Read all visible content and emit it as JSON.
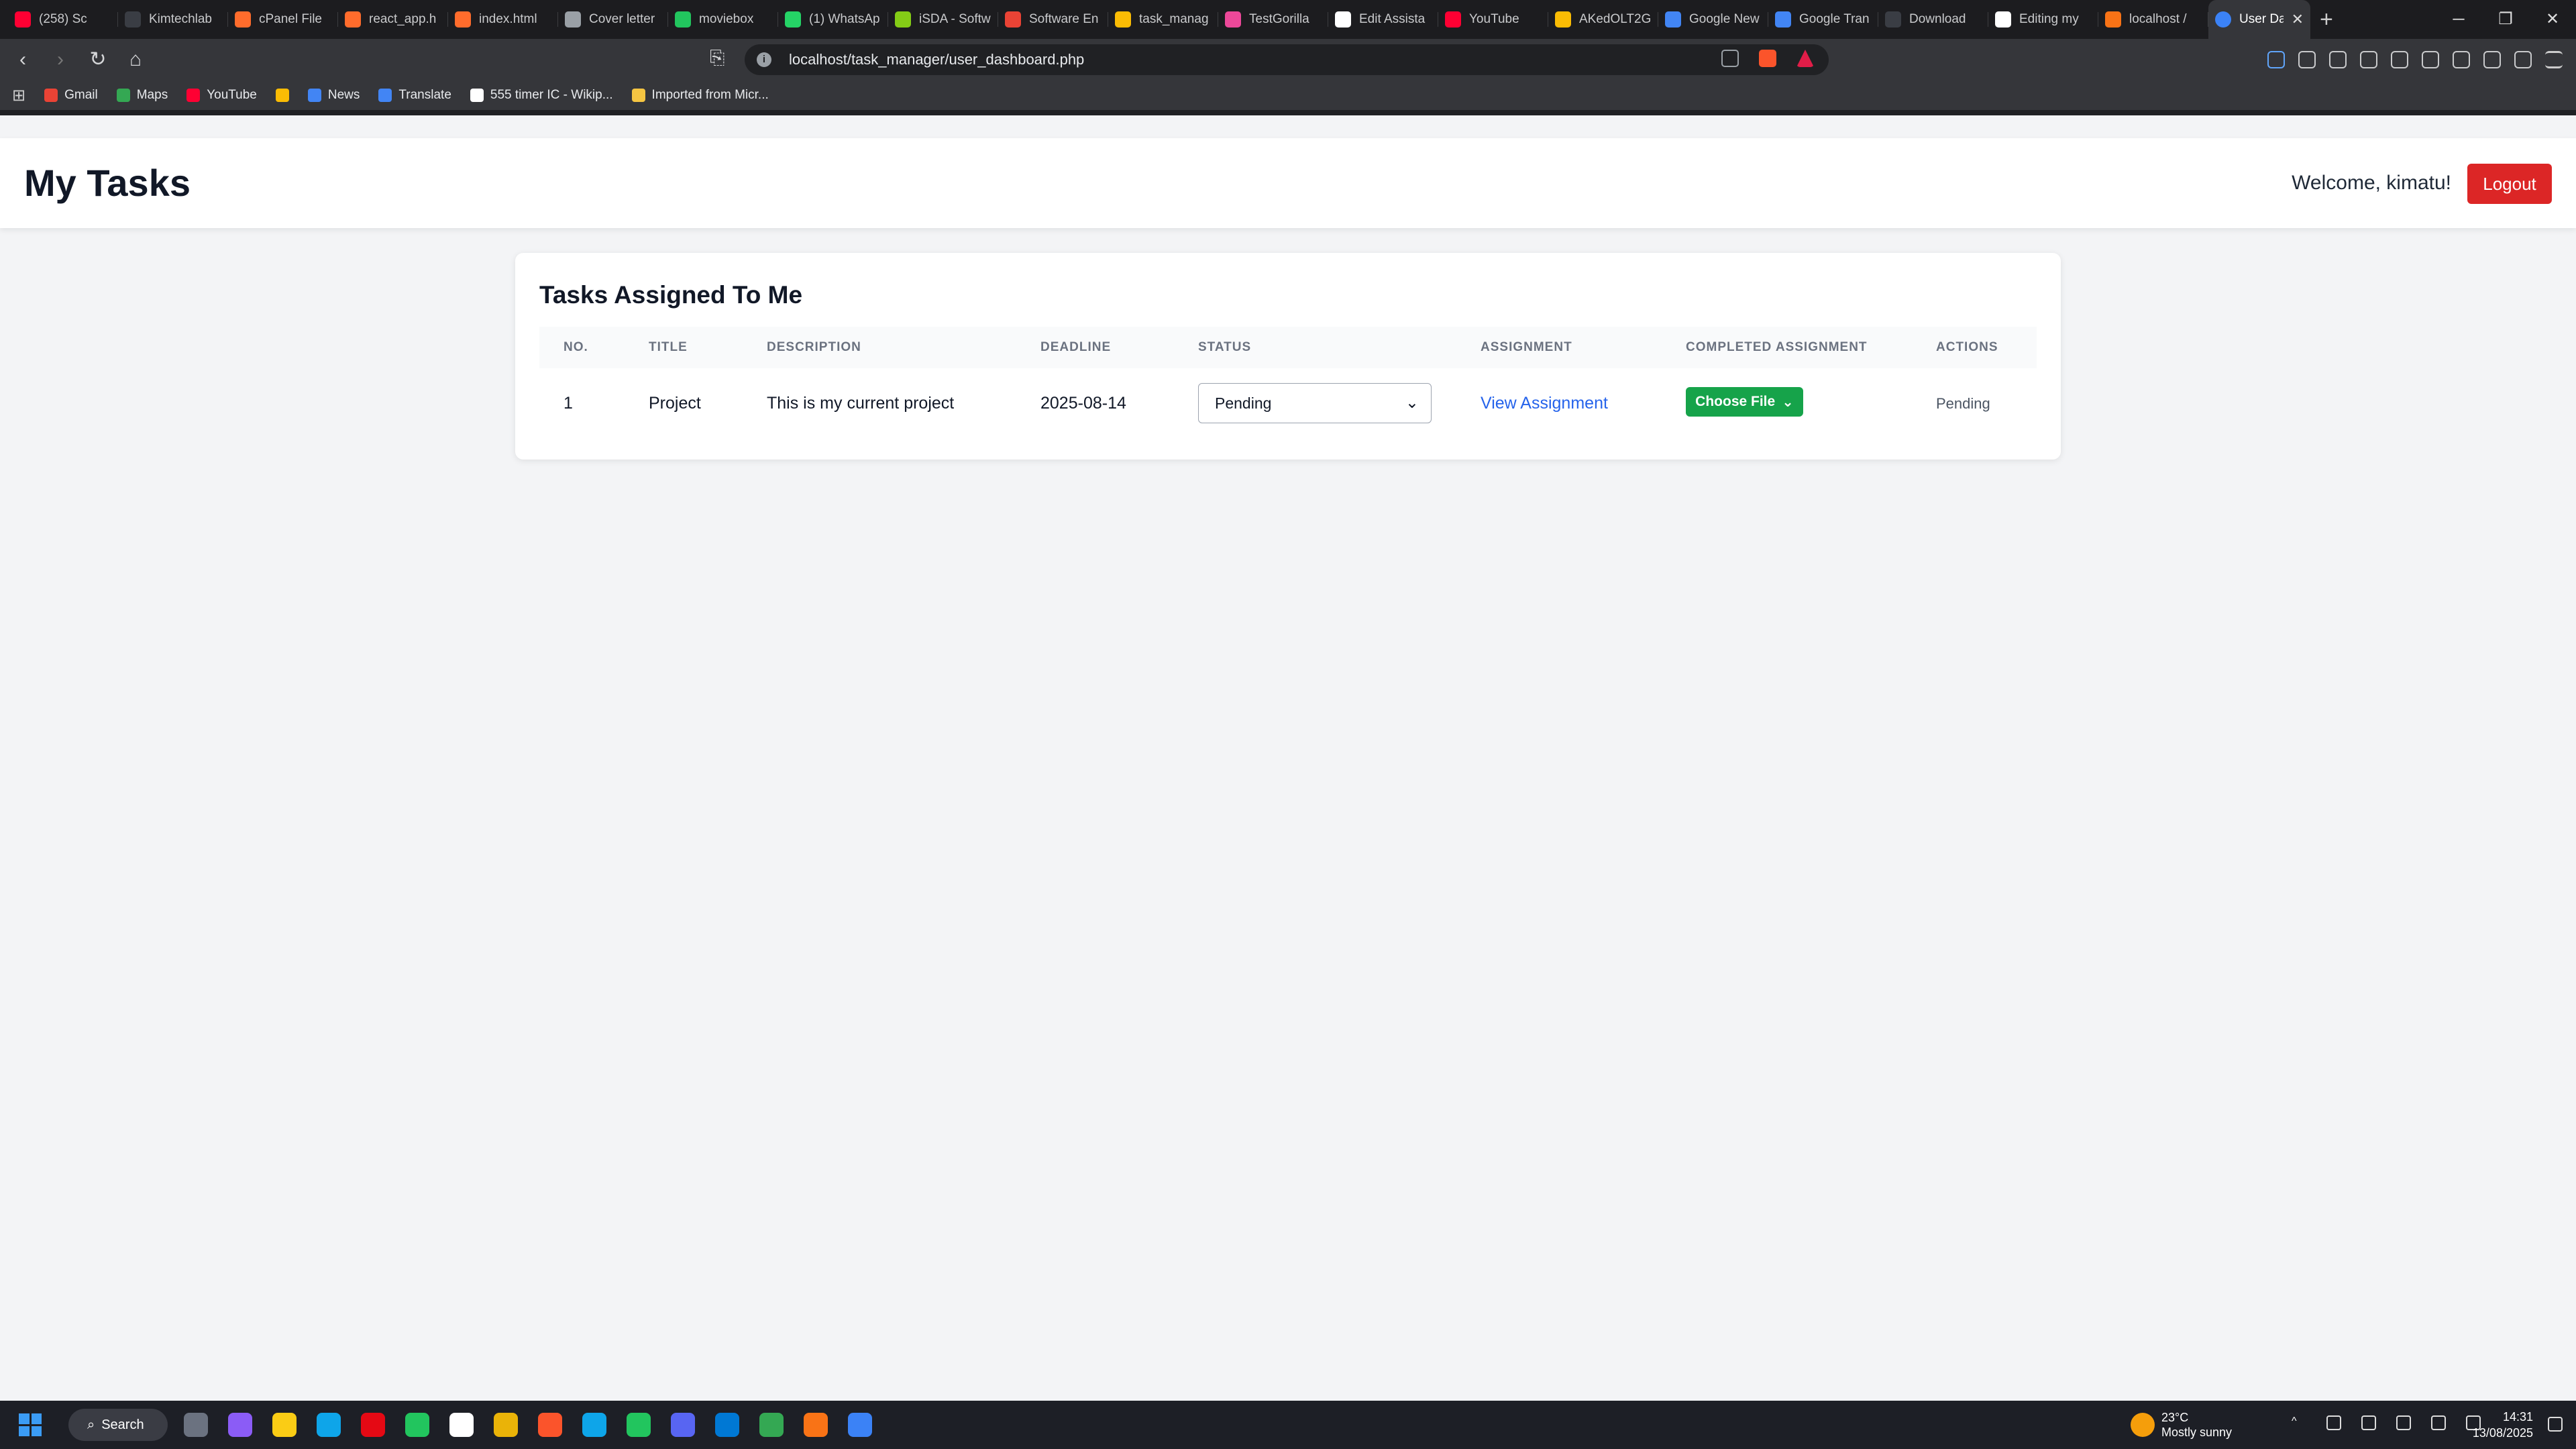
{
  "browser": {
    "tabs": [
      {
        "label": "(258) Sc",
        "color": "#ff0033"
      },
      {
        "label": "Kimtechlab",
        "color": "#3a3d44"
      },
      {
        "label": "cPanel File",
        "color": "#ff6c2c"
      },
      {
        "label": "react_app.h",
        "color": "#ff6c2c"
      },
      {
        "label": "index.html",
        "color": "#ff6c2c"
      },
      {
        "label": "Cover letter",
        "color": "#9aa0a6"
      },
      {
        "label": "moviebox",
        "color": "#22c55e"
      },
      {
        "label": "(1) WhatsAp",
        "color": "#25d366"
      },
      {
        "label": "iSDA - Softw",
        "color": "#84cc16"
      },
      {
        "label": "Software En",
        "color": "#ea4335"
      },
      {
        "label": "task_manag",
        "color": "#fbbc04"
      },
      {
        "label": "TestGorilla",
        "color": "#ec4899"
      },
      {
        "label": "Edit Assista",
        "color": "#ffffff"
      },
      {
        "label": "YouTube",
        "color": "#ff0033"
      },
      {
        "label": "AKedOLT2G",
        "color": "#fbbc04"
      },
      {
        "label": "Google New",
        "color": "#4285f4"
      },
      {
        "label": "Google Tran",
        "color": "#4285f4"
      },
      {
        "label": "Download",
        "color": "#3a3d44"
      },
      {
        "label": "Editing my",
        "color": "#ffffff"
      },
      {
        "label": "localhost /",
        "color": "#f97316"
      }
    ],
    "active_tab": {
      "label": "User Da",
      "color": "#3b82f6"
    },
    "new_tab": "+",
    "url": "localhost/task_manager/user_dashboard.php",
    "bookmarks": [
      {
        "label": "Gmail",
        "color": "#ea4335"
      },
      {
        "label": "Maps",
        "color": "#34a853"
      },
      {
        "label": "YouTube",
        "color": "#ff0033"
      },
      {
        "label": "",
        "color": "#fbbc04"
      },
      {
        "label": "News",
        "color": "#4285f4"
      },
      {
        "label": "Translate",
        "color": "#4285f4"
      },
      {
        "label": "555 timer IC - Wikip...",
        "color": "#ffffff"
      },
      {
        "label": "Imported from Micr...",
        "color": "#f5c542"
      }
    ]
  },
  "header": {
    "title": "My Tasks",
    "welcome": "Welcome, kimatu!",
    "logout_label": "Logout"
  },
  "tasks": {
    "title": "Tasks Assigned To Me",
    "columns": [
      "NO.",
      "TITLE",
      "DESCRIPTION",
      "DEADLINE",
      "STATUS",
      "ASSIGNMENT",
      "COMPLETED ASSIGNMENT",
      "ACTIONS"
    ],
    "rows": [
      {
        "no": "1",
        "title": "Project",
        "description": "This is my current project",
        "deadline": "2025-08-14",
        "status": "Pending",
        "assignment_link": "View Assignment",
        "upload_label": "Choose File",
        "action": "Pending"
      }
    ]
  },
  "taskbar": {
    "search_label": "Search",
    "weather_temp": "23°C",
    "weather_desc": "Mostly sunny",
    "time": "14:31",
    "date": "13/08/2025",
    "apps": [
      "#6b7280",
      "#8b5cf6",
      "#facc15",
      "#0ea5e9",
      "#e50914",
      "#22c55e",
      "#ffffff",
      "#eab308",
      "#fb542b",
      "#0ea5e9",
      "#22c55e",
      "#5865f2",
      "#0078d4",
      "#34a853",
      "#f97316",
      "#3b82f6"
    ],
    "accent": "#3b9cf5"
  },
  "colors": {
    "logout": "#dc2626",
    "choose_file": "#16a34a",
    "link": "#2563eb"
  }
}
